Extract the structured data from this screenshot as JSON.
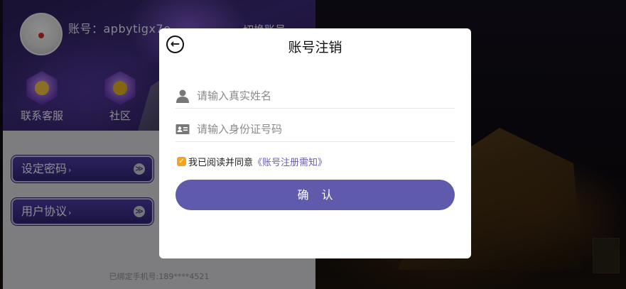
{
  "background_panel": {
    "account_label": "账号：apbytigx7e",
    "switch_account": "切换账号",
    "shortcuts": [
      {
        "label": "联系客服",
        "icon": "chat-icon"
      },
      {
        "label": "社区",
        "icon": "community-icon"
      }
    ],
    "menu": [
      {
        "label": "设定密码",
        "arrow": "›"
      },
      {
        "label": "用户协议",
        "arrow": "›"
      }
    ],
    "menu_circle_glyph": "≫",
    "bound_phone": "已绑定手机号:189****4521"
  },
  "modal": {
    "title": "账号注销",
    "back_icon": "back-arrow-icon",
    "name_field": {
      "placeholder": "请输入真实姓名",
      "icon": "user-icon",
      "value": ""
    },
    "id_field": {
      "placeholder": "请输入身份证号码",
      "icon": "id-card-icon",
      "value": ""
    },
    "agreement": {
      "checked": true,
      "text": "我已阅读并同意",
      "link": "《账号注册需知》"
    },
    "confirm_label": "确认"
  },
  "colors": {
    "accent": "#5f5aac",
    "checkbox": "#f2a61f",
    "link": "#6a5ab8"
  }
}
